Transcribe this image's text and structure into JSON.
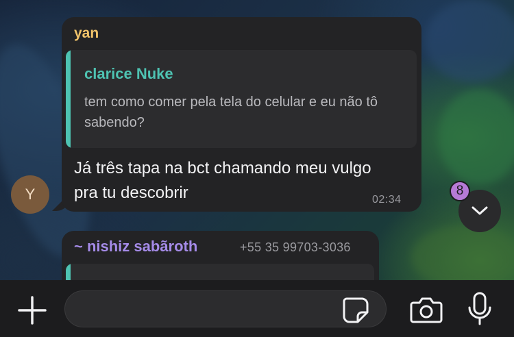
{
  "messages": [
    {
      "sender": "yan",
      "reply_to": {
        "author": "clarice Nuke",
        "text": "tem como comer pela tela do celular e eu não tô sabendo?"
      },
      "text": "Já três tapa na bct chamando meu vulgo pra tu descobrir",
      "time": "02:34"
    },
    {
      "sender": "~ nishiz sabãroth",
      "phone": "+55 35 99703-3036"
    }
  ],
  "avatar": {
    "initial": "Y"
  },
  "scroll_down": {
    "unread_count": "8",
    "icon": "chevron-down-icon"
  },
  "composer": {
    "value": "",
    "placeholder": "",
    "icons": [
      "plus-icon",
      "sticker-icon",
      "camera-icon",
      "microphone-icon"
    ]
  },
  "colors": {
    "bubble": "#232325",
    "sender_yan": "#f1c36a",
    "quote_accent": "#4ec3b2",
    "sender_nishiz": "#a58be8",
    "badge": "#b67ad6"
  }
}
